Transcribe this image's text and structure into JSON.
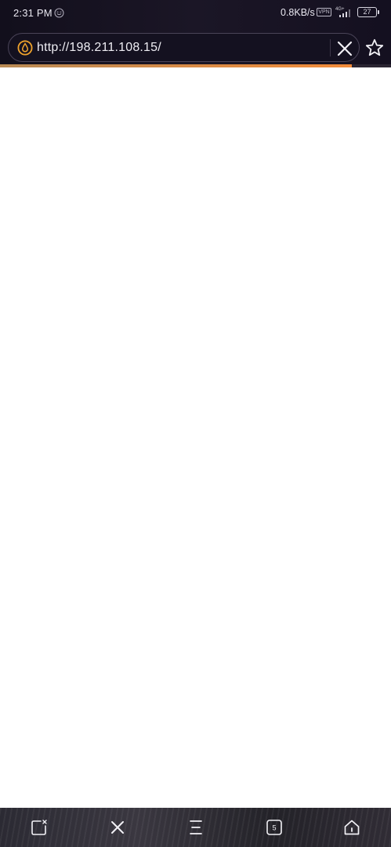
{
  "status_bar": {
    "time": "2:31 PM",
    "network_speed": "0.8KB/s",
    "vpn_label": "VPN",
    "network_type": "4G+",
    "battery_level": "27"
  },
  "address_bar": {
    "url": "http://198.211.108.15/",
    "site_icon": "orange-drop-icon",
    "clear_icon": "close-icon",
    "bookmark_icon": "star-outline-icon"
  },
  "load_progress": 0.9,
  "colors": {
    "chrome_background": "#141020",
    "progress_fill": "#f28b3a",
    "page_background": "#ffffff"
  },
  "bottom_nav": {
    "items": [
      {
        "icon": "new-tab-icon"
      },
      {
        "icon": "close-icon"
      },
      {
        "icon": "menu-icon"
      },
      {
        "icon": "tabs-icon",
        "count": "5"
      },
      {
        "icon": "home-icon"
      }
    ]
  }
}
